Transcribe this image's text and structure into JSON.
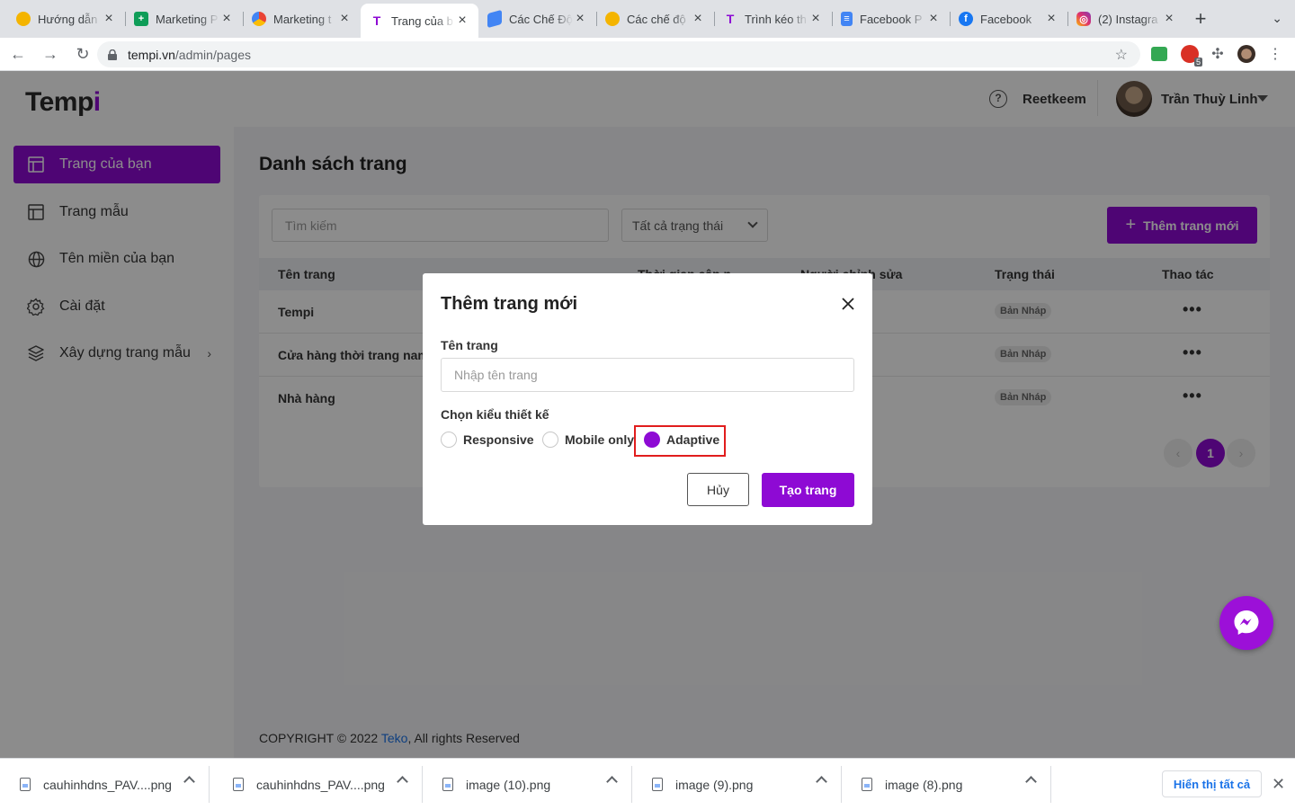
{
  "browser": {
    "tabs": [
      {
        "title": "Hướng dẫn",
        "icon": "hand-wave-icon",
        "color": "#f4b400"
      },
      {
        "title": "Marketing P",
        "icon": "sheets-icon",
        "color": "#0f9d58"
      },
      {
        "title": "Marketing t",
        "icon": "colorful-logo-icon",
        "color": "#ea4335"
      },
      {
        "title": "Trang của b",
        "icon": "tempi-t-icon",
        "color": "#8e0ad4",
        "active": true
      },
      {
        "title": "Các Chế Độ",
        "icon": "stack-icon",
        "color": "#4285f4"
      },
      {
        "title": "Các chế độ",
        "icon": "hand-wave-icon",
        "color": "#f4b400"
      },
      {
        "title": "Trình kéo th",
        "icon": "tempi-t-icon",
        "color": "#8e0ad4"
      },
      {
        "title": "Facebook P",
        "icon": "docs-icon",
        "color": "#4285f4"
      },
      {
        "title": "Facebook",
        "icon": "facebook-icon",
        "color": "#1877f2"
      },
      {
        "title": "(2) Instagra",
        "icon": "instagram-icon",
        "color": "#e1306c"
      }
    ],
    "url_host": "tempi.vn",
    "url_path": "/admin/pages",
    "ext_badge": "5"
  },
  "sidebar": {
    "logo_main": "Temp",
    "logo_accent": "i",
    "items": [
      {
        "label": "Trang của bạn",
        "icon": "layout-icon"
      },
      {
        "label": "Trang mẫu",
        "icon": "template-icon"
      },
      {
        "label": "Tên miền của bạn",
        "icon": "globe-icon"
      },
      {
        "label": "Cài đặt",
        "icon": "gear-icon"
      },
      {
        "label": "Xây dựng trang mẫu",
        "icon": "layers-icon"
      }
    ]
  },
  "header": {
    "help": "?",
    "team": "Reetkeem",
    "user": "Trần Thuỳ Linh"
  },
  "main": {
    "title": "Danh sách trang",
    "search_placeholder": "Tìm kiếm",
    "status_filter": "Tất cả trạng thái",
    "add_label": "Thêm trang mới",
    "columns": [
      "Tên trang",
      "Thời gian cập n",
      "Người chỉnh sửa",
      "Trạng thái",
      "Thao tác"
    ],
    "rows": [
      {
        "name": "Tempi",
        "status": "Bản Nháp"
      },
      {
        "name": "Cửa hàng thời trang nam",
        "status": "Bản Nháp"
      },
      {
        "name": "Nhà hàng",
        "status": "Bản Nháp"
      }
    ],
    "page": "1",
    "prev": "‹",
    "next": "›",
    "actions": "•••"
  },
  "footer": {
    "prefix": "COPYRIGHT © 2022 ",
    "link": "Teko",
    "suffix": ", All rights Reserved"
  },
  "modal": {
    "title": "Thêm trang mới",
    "name_label": "Tên trang",
    "name_placeholder": "Nhập tên trang",
    "design_label": "Chọn kiểu thiết kế",
    "options": [
      "Responsive",
      "Mobile only",
      "Adaptive"
    ],
    "selected": "Adaptive",
    "cancel": "Hủy",
    "create": "Tạo trang"
  },
  "downloads": {
    "files": [
      "cauhinhdns_PAV....png",
      "cauhinhdns_PAV....png",
      "image (10).png",
      "image (9).png",
      "image (8).png"
    ],
    "show_all": "Hiển thị tất cả"
  },
  "colors": {
    "accent": "#8e0ad4",
    "highlight": "#e11d1d",
    "link": "#1a73e8"
  }
}
